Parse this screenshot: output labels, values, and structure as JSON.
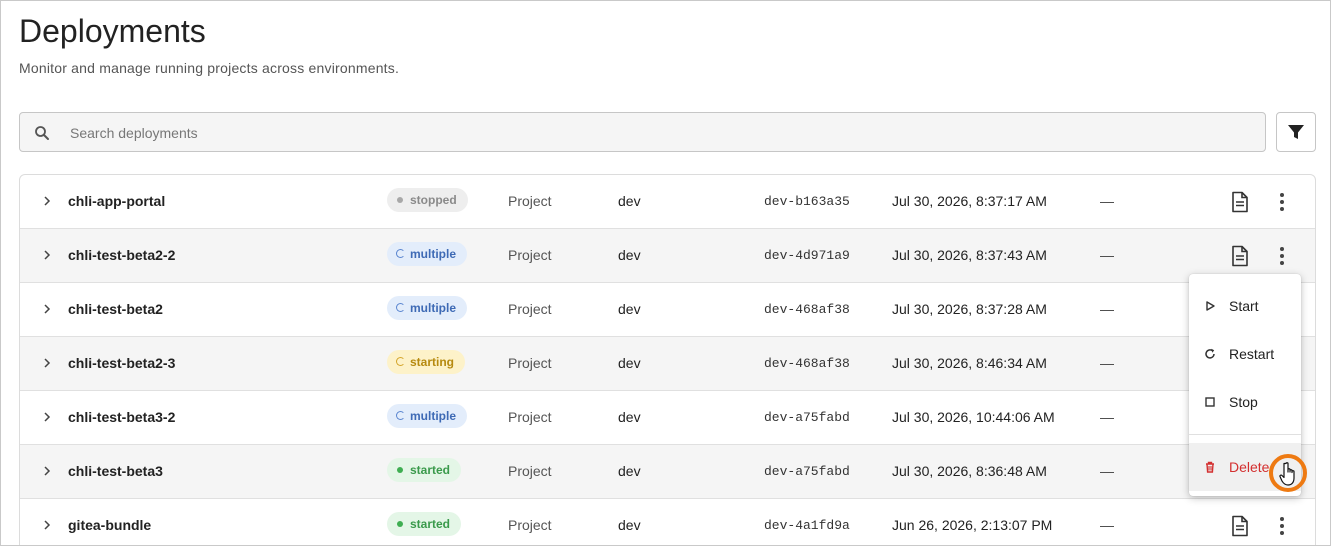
{
  "page": {
    "title": "Deployments",
    "subtitle": "Monitor and manage running projects across environments."
  },
  "search": {
    "placeholder": "Search deployments",
    "icon": "search-icon"
  },
  "filter": {
    "icon": "filter-icon"
  },
  "rows": [
    {
      "name": "chli-app-portal",
      "status": "stopped",
      "type": "Project",
      "env": "dev",
      "revision": "dev-b163a35",
      "updated": "Jul 30, 2026, 8:37:17 AM",
      "extra": "—"
    },
    {
      "name": "chli-test-beta2-2",
      "status": "multiple",
      "type": "Project",
      "env": "dev",
      "revision": "dev-4d971a9",
      "updated": "Jul 30, 2026, 8:37:43 AM",
      "extra": "—"
    },
    {
      "name": "chli-test-beta2",
      "status": "multiple",
      "type": "Project",
      "env": "dev",
      "revision": "dev-468af38",
      "updated": "Jul 30, 2026, 8:37:28 AM",
      "extra": "—"
    },
    {
      "name": "chli-test-beta2-3",
      "status": "starting",
      "type": "Project",
      "env": "dev",
      "revision": "dev-468af38",
      "updated": "Jul 30, 2026, 8:46:34 AM",
      "extra": "—"
    },
    {
      "name": "chli-test-beta3-2",
      "status": "multiple",
      "type": "Project",
      "env": "dev",
      "revision": "dev-a75fabd",
      "updated": "Jul 30, 2026, 10:44:06 AM",
      "extra": "—"
    },
    {
      "name": "chli-test-beta3",
      "status": "started",
      "type": "Project",
      "env": "dev",
      "revision": "dev-a75fabd",
      "updated": "Jul 30, 2026, 8:36:48 AM",
      "extra": "—"
    },
    {
      "name": "gitea-bundle",
      "status": "started",
      "type": "Project",
      "env": "dev",
      "revision": "dev-4a1fd9a",
      "updated": "Jun 26, 2026, 2:13:07 PM",
      "extra": "—"
    }
  ],
  "context_menu": {
    "items": [
      {
        "label": "Start",
        "icon": "play-icon"
      },
      {
        "label": "Restart",
        "icon": "restart-icon"
      },
      {
        "label": "Stop",
        "icon": "stop-icon"
      },
      {
        "label": "Delete",
        "icon": "trash-icon",
        "danger": true
      }
    ]
  },
  "colors": {
    "stopped": "#8a8a8a",
    "multiple": "#3e6ab5",
    "starting": "#b68a10",
    "started": "#3a9a4b",
    "danger": "#d32f2f",
    "cursor_highlight": "#ee7a12"
  }
}
